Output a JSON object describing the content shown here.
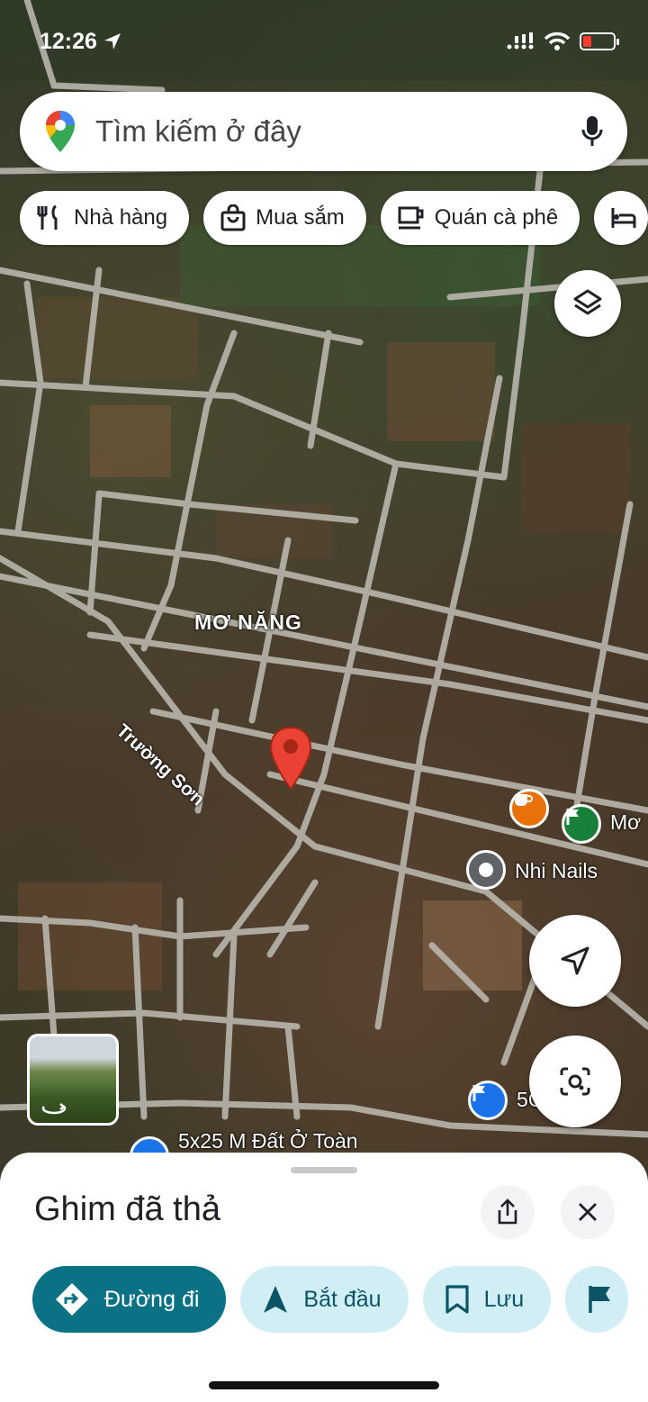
{
  "status_bar": {
    "time": "12:26"
  },
  "search": {
    "placeholder": "Tìm kiếm ở đây"
  },
  "chips": [
    {
      "label": "Nhà hàng",
      "icon": "restaurant-icon"
    },
    {
      "label": "Mua sắm",
      "icon": "shopping-bag-icon"
    },
    {
      "label": "Quán cà phê",
      "icon": "coffee-icon"
    }
  ],
  "map": {
    "area_label": "MƠ NĂNG",
    "road_label": "Trường Sơn",
    "pois": [
      {
        "label": "Mơ",
        "icon": "flag-icon",
        "color": "#188038"
      },
      {
        "label": "Nhi Nails",
        "icon": "place-icon",
        "color": "#5f6368"
      },
      {
        "label": "5Ch...em",
        "icon": "flag-icon",
        "color": "#1a73e8"
      },
      {
        "label": "5x25 M Đất Ở Toàn",
        "icon": "flag-icon",
        "color": "#1a73e8"
      }
    ],
    "cafe_color": "#e8710a",
    "pin_color": "#ea4335"
  },
  "sheet": {
    "title": "Ghim đã thả",
    "actions": [
      {
        "label": "Đường đi"
      },
      {
        "label": "Bắt đầu"
      },
      {
        "label": "Lưu"
      }
    ]
  },
  "colors": {
    "primary": "#0b7285",
    "secondary_bg": "#d2eef5"
  }
}
